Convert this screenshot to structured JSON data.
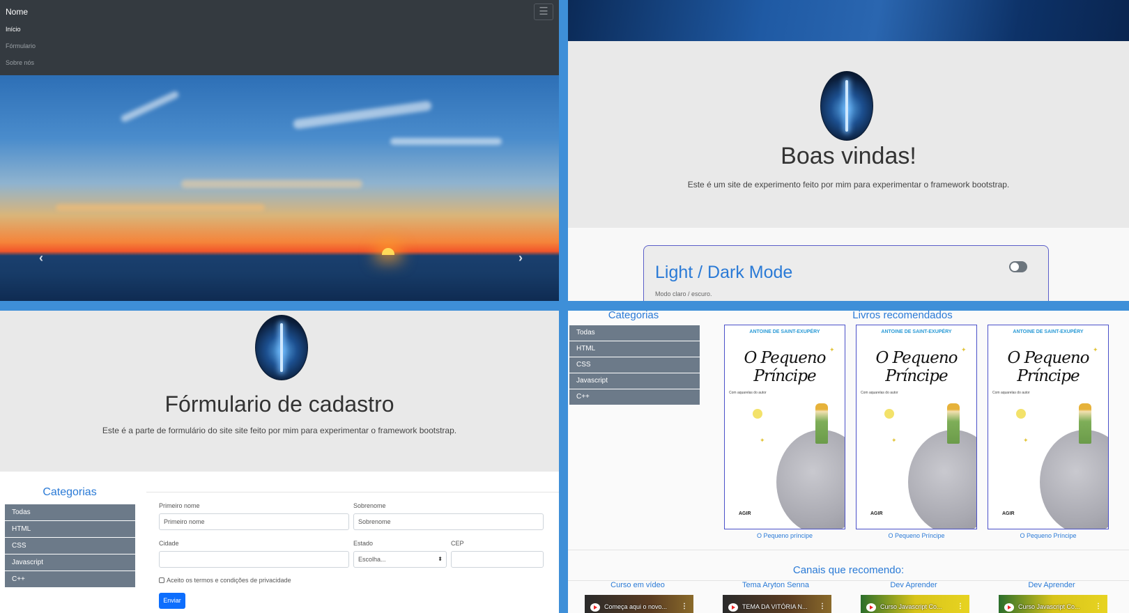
{
  "navbar": {
    "brand": "Nome",
    "toggler_icon": "menu-icon",
    "links": [
      "Início",
      "Fórmulario",
      "Sobre nós"
    ]
  },
  "carousel": {
    "prev_icon": "chevron-left-icon",
    "next_icon": "chevron-right-icon"
  },
  "welcome": {
    "title": "Boas vindas!",
    "lead": "Este é um site de experimento feito por mim para experimentar o framework bootstrap."
  },
  "mode_card": {
    "title": "Light / Dark Mode",
    "subtitle": "Modo claro / escuro.",
    "switch_on": false
  },
  "form_page": {
    "title": "Fórmulario de cadastro",
    "lead": "Este é a parte de formulário do site site feito por mim para experimentar o framework bootstrap."
  },
  "categories": {
    "title": "Categorias",
    "items": [
      "Todas",
      "HTML",
      "CSS",
      "Javascript",
      "C++"
    ]
  },
  "form": {
    "first_name_label": "Primeiro nome",
    "first_name_placeholder": "Primeiro nome",
    "last_name_label": "Sobrenome",
    "last_name_placeholder": "Sobrenome",
    "city_label": "Cidade",
    "city_value": "",
    "state_label": "Estado",
    "state_selected": "Escolha...",
    "zip_label": "CEP",
    "zip_value": "",
    "terms_label": "Aceito os termos e condições de privacidade",
    "submit_label": "Enviar"
  },
  "books": {
    "title": "Livros recomendados",
    "items": [
      {
        "author": "ANTOINE DE SAINT-EXUPÉRY",
        "cover_title": "O Pequeno Príncipe",
        "cover_sub": "Com aquarelas do autor",
        "publisher": "AGIR",
        "caption": "O Pequeno príncipe"
      },
      {
        "author": "ANTOINE DE SAINT-EXUPÉRY",
        "cover_title": "O Pequeno Príncipe",
        "cover_sub": "Com aquarelas do autor",
        "publisher": "AGIR",
        "caption": "O Pequeno Príncipe"
      },
      {
        "author": "ANTOINE DE SAINT-EXUPÉRY",
        "cover_title": "O Pequeno Príncipe",
        "cover_sub": "Com aquarelas do autor",
        "publisher": "AGIR",
        "caption": "O Pequeno Príncipe"
      }
    ]
  },
  "channels": {
    "title": "Canais que recomendo:",
    "items": [
      {
        "name": "Curso em vídeo",
        "video_title": "Começa aqui o novo..."
      },
      {
        "name": "Tema Aryton Senna",
        "video_title": "TEMA DA VITÓRIA N..."
      },
      {
        "name": "Dev Aprender",
        "video_title": "Curso Javascript Co..."
      },
      {
        "name": "Dev Aprender",
        "video_title": "Curso Javascript Co..."
      }
    ]
  }
}
